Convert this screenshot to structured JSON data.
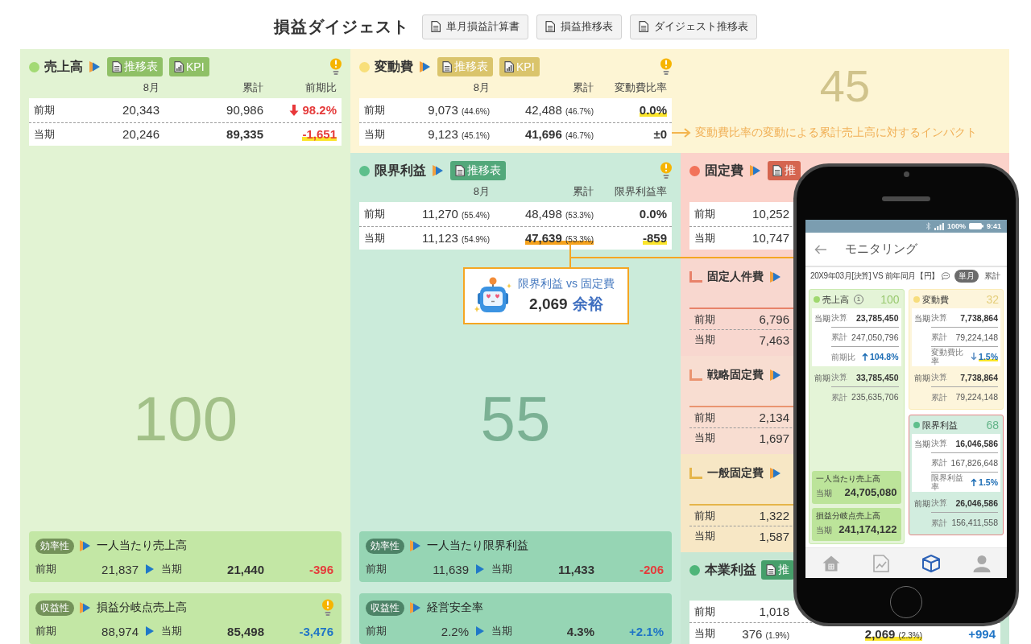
{
  "header": {
    "title": "損益ダイジェスト",
    "buttons": [
      "単月損益計算書",
      "損益推移表",
      "ダイジェスト推移表"
    ]
  },
  "sales": {
    "title": "売上高",
    "color": "#a3da74",
    "drilldown": true,
    "buttons": [
      {
        "label": "推移表",
        "kind": "table"
      },
      {
        "label": "KPI",
        "kind": "kpi"
      }
    ],
    "tip": true,
    "columns": [
      "8月",
      "累計",
      "前期比"
    ],
    "rows": [
      {
        "label": "前期",
        "current": false,
        "cells": [
          {
            "value": "20,343"
          },
          {
            "value": "90,986"
          },
          {
            "value": "98.2%",
            "color": "#e53b3b",
            "kind": "down"
          }
        ]
      },
      {
        "label": "当期",
        "current": true,
        "cells": [
          {
            "value": "20,246"
          },
          {
            "value": "89,335"
          },
          {
            "value": "-1,651",
            "color": "#e53b3b",
            "highlight": {
              "color": "#fbe52b"
            }
          }
        ]
      }
    ],
    "score": "100",
    "kpis": [
      {
        "tag": "効率性",
        "title": "一人当たり売上高",
        "tip": false,
        "before_label": "前期",
        "before": "21,837",
        "after_label": "当期",
        "after": "21,440",
        "diff": "-396",
        "color": "#e53b3b"
      },
      {
        "tag": "収益性",
        "title": "損益分岐点売上高",
        "tip": true,
        "before_label": "前期",
        "before": "88,974",
        "after_label": "当期",
        "after": "85,498",
        "diff": "-3,476",
        "color": "#1f74c6"
      }
    ]
  },
  "variable_cost": {
    "title": "変動費",
    "color": "#f8df7a",
    "drilldown": true,
    "buttons": [
      {
        "label": "推移表",
        "kind": "table"
      },
      {
        "label": "KPI",
        "kind": "kpi"
      }
    ],
    "tip": true,
    "columns": [
      "8月",
      "累計",
      "変動費比率"
    ],
    "rows": [
      {
        "label": "前期",
        "current": false,
        "cells": [
          {
            "value": "9,073",
            "pct": "(44.6%)"
          },
          {
            "value": "42,488",
            "pct": "(46.7%)"
          },
          {
            "value": "0.0%",
            "highlight": {
              "color": "#fbe52b"
            }
          }
        ]
      },
      {
        "label": "当期",
        "current": true,
        "cells": [
          {
            "value": "9,123",
            "pct": "(45.1%)"
          },
          {
            "value": "41,696",
            "pct": "(46.7%)"
          },
          {
            "value": "±0"
          }
        ]
      }
    ],
    "score": "45",
    "impact_note": "変動費比率の変動による累計売上高に対するインパクト"
  },
  "marginal_profit": {
    "title": "限界利益",
    "color": "#5dbf8b",
    "drilldown": true,
    "buttons": [
      {
        "label": "推移表",
        "kind": "table"
      }
    ],
    "tip": true,
    "columns": [
      "8月",
      "累計",
      "限界利益率"
    ],
    "rows": [
      {
        "label": "前期",
        "current": false,
        "cells": [
          {
            "value": "11,270",
            "pct": "(55.4%)"
          },
          {
            "value": "48,498",
            "pct": "(53.3%)"
          },
          {
            "value": "0.0%"
          }
        ]
      },
      {
        "label": "当期",
        "current": true,
        "cells": [
          {
            "value": "11,123",
            "pct": "(54.9%)"
          },
          {
            "value": "47,639",
            "pct": "(53.3%)",
            "highlight": {
              "color": "#f6a21c"
            }
          },
          {
            "value": "-859",
            "highlight": {
              "color": "#fbe52b"
            }
          }
        ]
      }
    ],
    "callout": {
      "title": "限界利益 vs 固定費",
      "value": "2,069",
      "verdict": "余裕"
    },
    "score": "55",
    "kpis": [
      {
        "tag": "効率性",
        "title": "一人当たり限界利益",
        "tip": false,
        "before_label": "前期",
        "before": "11,639",
        "after_label": "当期",
        "after": "11,433",
        "diff": "-206",
        "color": "#e53b3b"
      },
      {
        "tag": "収益性",
        "title": "経営安全率",
        "tip": false,
        "before_label": "前期",
        "before": "2.2%",
        "after_label": "当期",
        "after": "4.3%",
        "diff": "+2.1%",
        "color": "#1f74c6"
      }
    ]
  },
  "fixed_cost": {
    "title": "固定費",
    "color": "#f2735a",
    "drilldown": true,
    "buttons": [
      {
        "label": "推",
        "kind": "table"
      }
    ],
    "rows": [
      {
        "label": "前期",
        "cells": [
          {
            "value": "10,252"
          }
        ]
      },
      {
        "label": "当期",
        "cells": [
          {
            "value": "10,747"
          }
        ]
      }
    ],
    "breakdown": [
      {
        "title": "固定人件費",
        "color": "#e8826a",
        "drilldown": true,
        "rows": [
          {
            "label": "前期",
            "cells": [
              {
                "value": "6,796"
              }
            ]
          },
          {
            "label": "当期",
            "cells": [
              {
                "value": "7,463"
              }
            ]
          }
        ]
      },
      {
        "title": "戦略固定費",
        "color": "#ea9470",
        "drilldown": true,
        "rows": [
          {
            "label": "前期",
            "cells": [
              {
                "value": "2,134"
              }
            ]
          },
          {
            "label": "当期",
            "cells": [
              {
                "value": "1,697"
              }
            ]
          }
        ]
      },
      {
        "title": "一般固定費",
        "color": "#e5b54a",
        "drilldown": true,
        "rows": [
          {
            "label": "前期",
            "cells": [
              {
                "value": "1,322"
              }
            ]
          },
          {
            "label": "当期",
            "cells": [
              {
                "value": "1,587"
              }
            ]
          }
        ]
      }
    ]
  },
  "operating_profit": {
    "title": "本業利益",
    "color": "#4fb579",
    "drilldown": false,
    "buttons": [
      {
        "label": "推",
        "kind": "table"
      }
    ],
    "rows": [
      {
        "label": "前期",
        "cells": [
          {
            "value": "1,018"
          }
        ]
      },
      {
        "label": "当期",
        "current": true,
        "cells": [
          {
            "value": "376",
            "pct": "(1.9%)"
          },
          {
            "value": "2,069",
            "pct": "(2.3%)",
            "highlight": {
              "color": "#fbe52b"
            }
          },
          {
            "value": "+994",
            "color": "#1f74c6"
          }
        ]
      }
    ]
  },
  "phone": {
    "status": {
      "battery": "100%",
      "time": "9:41"
    },
    "title": "モニタリング",
    "period": "20X9年03月[決算] VS 前年同月【円】",
    "modes": [
      {
        "label": "単月",
        "selected": true
      },
      {
        "label": "累計",
        "selected": false
      }
    ],
    "columns": [
      [
        {
          "title": "売上高",
          "color": "#9fd86f",
          "badge": "1",
          "score": "100",
          "selected": false,
          "blocks": [
            {
              "label": "当期",
              "boxed": true,
              "rows": [
                {
                  "label": "決算",
                  "value": "23,785,450"
                },
                {
                  "label": "累計",
                  "value": "247,050,796"
                },
                {
                  "label": "前期比",
                  "value": "104.8%",
                  "kind": "up"
                }
              ]
            },
            {
              "label": "前期",
              "boxed": false,
              "rows": [
                {
                  "label": "決算",
                  "value": "33,785,450"
                },
                {
                  "label": "累計",
                  "value": "235,635,706"
                }
              ]
            }
          ],
          "kpis": [
            {
              "title": "一人当たり売上高",
              "label": "当期",
              "value": "24,705,080"
            },
            {
              "title": "損益分岐点売上高",
              "label": "当期",
              "value": "241,174,122"
            }
          ]
        }
      ],
      [
        {
          "title": "変動費",
          "color": "#f7dd7d",
          "score": "32",
          "selected": false,
          "blocks": [
            {
              "label": "当期",
              "boxed": true,
              "rows": [
                {
                  "label": "決算",
                  "value": "7,738,864"
                },
                {
                  "label": "累計",
                  "value": "79,224,148"
                },
                {
                  "label": "変動費比率",
                  "value": "1.5%",
                  "kind": "down",
                  "highlight": {
                    "color": "#fbe52b"
                  }
                }
              ]
            },
            {
              "label": "前期",
              "boxed": false,
              "rows": [
                {
                  "label": "決算",
                  "value": "7,738,864"
                },
                {
                  "label": "累計",
                  "value": "79,224,148"
                }
              ]
            }
          ]
        },
        {
          "title": "限界利益",
          "color": "#5fbf8c",
          "score": "68",
          "selected": true,
          "blocks": [
            {
              "label": "当期",
              "boxed": true,
              "rows": [
                {
                  "label": "決算",
                  "value": "16,046,586"
                },
                {
                  "label": "累計",
                  "value": "167,826,648"
                },
                {
                  "label": "限界利益率",
                  "value": "1.5%",
                  "kind": "up"
                }
              ]
            },
            {
              "label": "前期",
              "boxed": false,
              "rows": [
                {
                  "label": "決算",
                  "value": "26,046,586"
                },
                {
                  "label": "累計",
                  "value": "156,411,558"
                }
              ]
            }
          ]
        }
      ]
    ],
    "nav": [
      {
        "kind": "home",
        "selected": false
      },
      {
        "kind": "report",
        "selected": false
      },
      {
        "kind": "cube",
        "selected": true
      },
      {
        "kind": "user",
        "selected": false
      }
    ]
  }
}
